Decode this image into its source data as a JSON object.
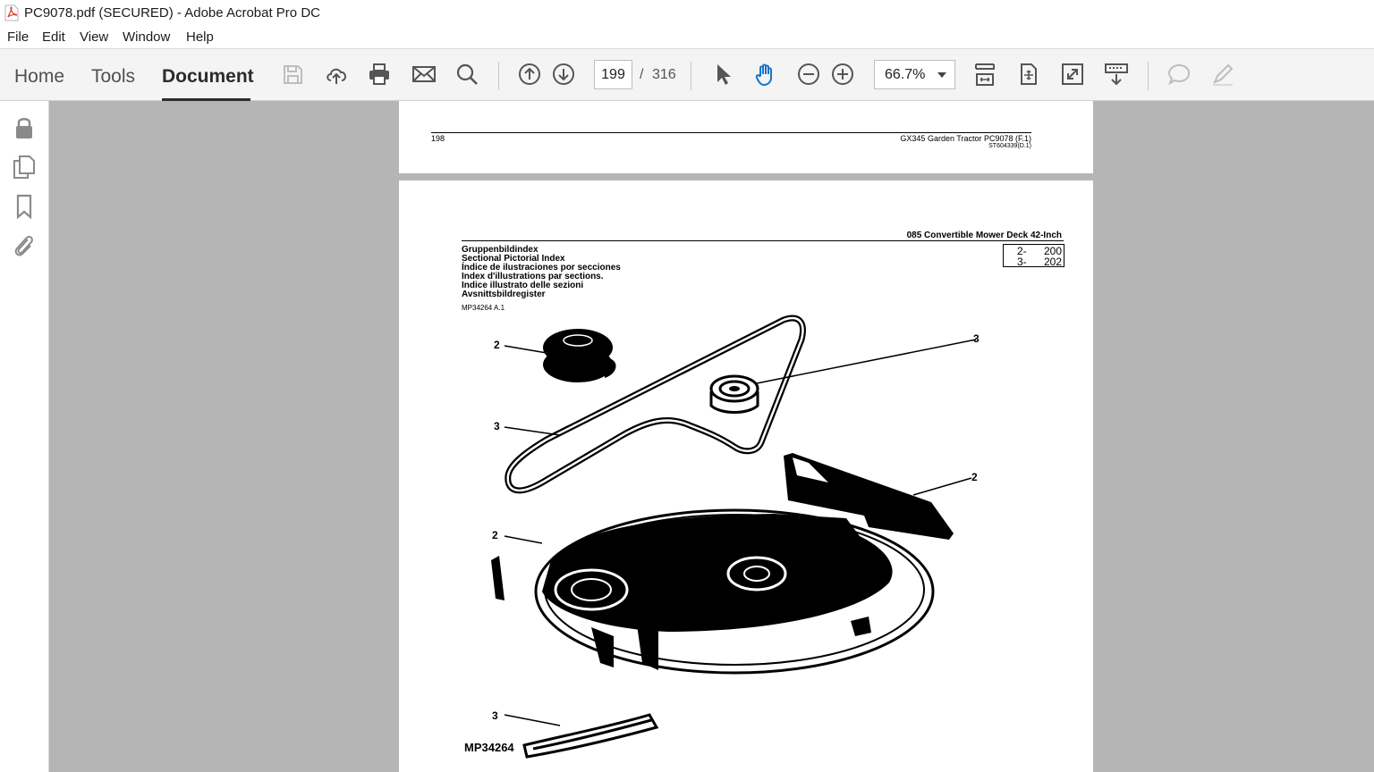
{
  "window": {
    "title": "PC9078.pdf (SECURED) - Adobe Acrobat Pro DC"
  },
  "menu": {
    "file": "File",
    "edit": "Edit",
    "view": "View",
    "window": "Window",
    "help": "Help"
  },
  "nav_tabs": {
    "home": "Home",
    "tools": "Tools",
    "document": "Document"
  },
  "navigation": {
    "current_page": "199",
    "separator": "/",
    "total_pages": "316"
  },
  "zoom": {
    "value": "66.7%"
  },
  "page_198": {
    "page_number": "198",
    "header_right": "GX345 Garden Tractor   PC9078   (F.1)",
    "doc_ref": "ST604339(D.1)"
  },
  "page_199": {
    "section_title": "085  Convertible  Mower  Deck  42-Inch",
    "index_lines": [
      "Gruppenbildindex",
      "Sectional Pictorial Index",
      "Índice de ilustraciones por secciones",
      "Index d'illustrations par sections.",
      "Indice illustrato delle sezioni",
      "Avsnittsbildregister"
    ],
    "ref_code": "MP34264 A.1",
    "index_table": [
      {
        "group": "2-",
        "page": "200"
      },
      {
        "group": "3-",
        "page": "202"
      }
    ],
    "callouts": [
      "2",
      "3",
      "3",
      "2",
      "2",
      "3"
    ],
    "figure_id": "MP34264"
  },
  "colors": {
    "accent": "#2c2c2c",
    "viewer_bg": "#b5b5b5",
    "toolbar_bg": "#f4f4f4",
    "pdf_red": "#d8362a"
  }
}
